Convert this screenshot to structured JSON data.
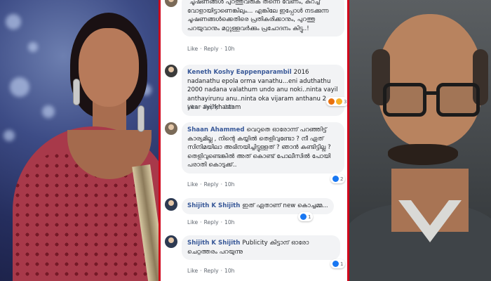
{
  "comments": [
    {
      "author": "",
      "text": "ചൂഷണങ്ങൾ പുറത്തുവരുക തന്നെ വേണം, കുറച്ച് വോളായിട്ടാണെങ്കിലും... എങ്കിലേ ഇപ്പോൾ നടക്കുന്ന ചൂഷണങ്ങൾക്കെതിരെ പ്രതികരിക്കാനും, പുറത്തു പറയുവാനും മറ്റുള്ളവർക്കും പ്രചോദനം കിട്ടു..!",
      "like": "Like",
      "reply": "Reply",
      "time": "10h",
      "reaction_count": ""
    },
    {
      "author": "Keneth Koshy Eappenparambil",
      "text": "2016 nadanathu epola orma vanathu...eni aduthathu 2000 nadana valathum undo anu noki..ninta vayil anthayirunu anu..ninta oka vijaram anthanu 2 year ayi?khastam",
      "like": "Like",
      "reply": "Reply",
      "time": "10h",
      "reaction_count": "3"
    },
    {
      "author": "Shaan Ahammed",
      "text": "വെറുതെ ഓരോന്ന് പറഞ്ഞിട്ട് കാര്യമില്ല , നിന്റെ കയ്യിൽ തെളിവുണ്ടോ ? നീ ഏത് സിനിമയിലാ അഭിനയിച്ചിട്ടുള്ളത് ? ഞാൻ കണ്ടിട്ടില്ല ? തെളിവുണ്ടെങ്കിൽ അത് കൊണ്ട് പോലീസിൽ പോയി പരാതി കൊടുക്ക്..",
      "like": "Like",
      "reply": "Reply",
      "time": "10h",
      "reaction_count": "2"
    },
    {
      "author": "Shijith K Shijith",
      "text": "ഇത് ഏതാണ് new കൊച്ചമ്മ...",
      "like": "Like",
      "reply": "Reply",
      "time": "10h",
      "reaction_count": "1"
    },
    {
      "author": "Shijith K Shijith",
      "text": "Publicity കിട്ടാന് ഓരോ ചെറ്റത്തരം പറയുന്നു",
      "like": "Like",
      "reply": "Reply",
      "time": "10h",
      "reaction_count": "1"
    }
  ],
  "colors": {
    "panel_border": "#d0021b",
    "author_link": "#385898",
    "bubble_bg": "#f2f3f5"
  }
}
